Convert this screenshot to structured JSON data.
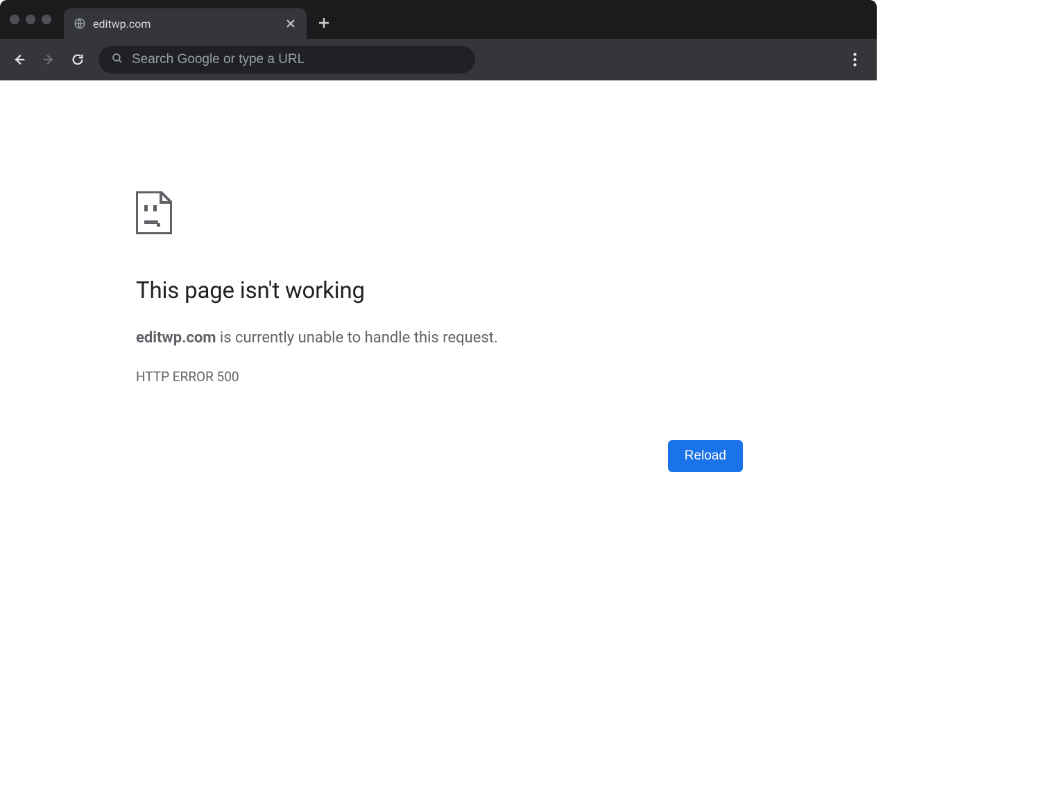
{
  "tab": {
    "title": "editwp.com"
  },
  "toolbar": {
    "omnibox_placeholder": "Search Google or type a URL"
  },
  "error": {
    "headline": "This page isn't working",
    "host": "editwp.com",
    "message_suffix": " is currently unable to handle this request.",
    "code": "HTTP ERROR 500",
    "reload_label": "Reload"
  }
}
